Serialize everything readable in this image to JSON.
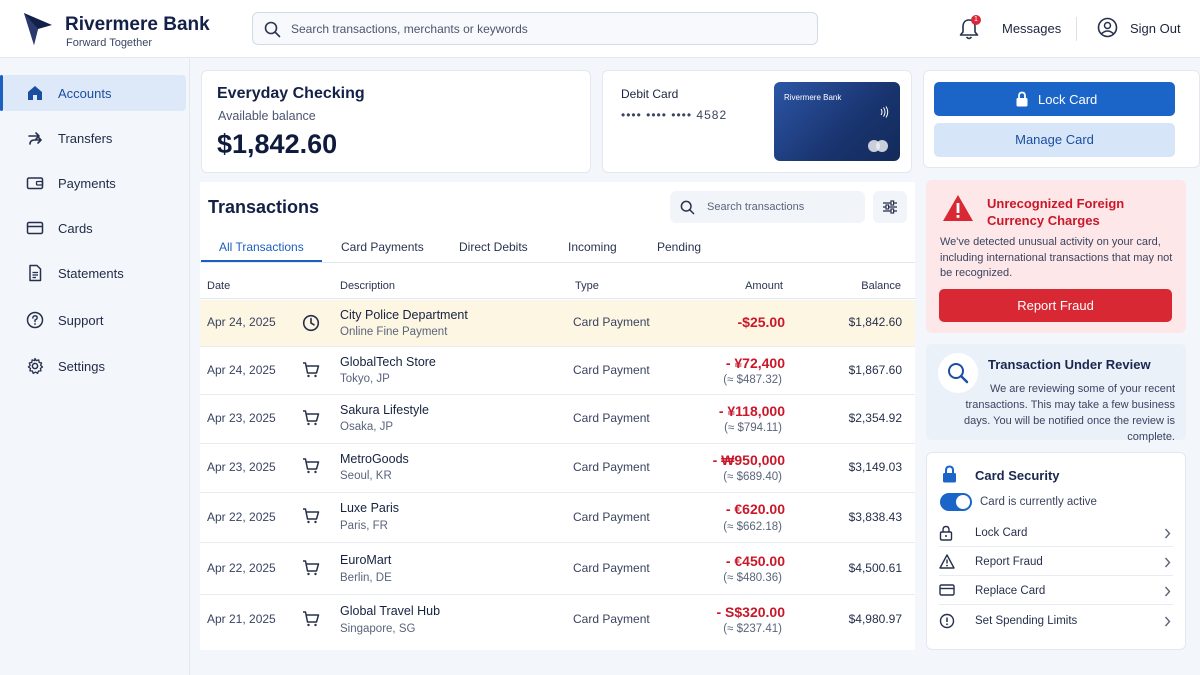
{
  "brand": {
    "name": "Rivermere Bank",
    "tagline": "Forward Together"
  },
  "header": {
    "search_placeholder": "Search transactions, merchants or keywords",
    "notification_count": "1",
    "messages_label": "Messages",
    "sign_out_label": "Sign Out"
  },
  "sidebar": {
    "items": [
      {
        "label": "Accounts",
        "icon": "home-icon",
        "active": true
      },
      {
        "label": "Transfers",
        "icon": "transfer-arrows-icon"
      },
      {
        "label": "Payments",
        "icon": "wallet-icon"
      },
      {
        "label": "Cards",
        "icon": "credit-card-icon"
      },
      {
        "label": "Statements",
        "icon": "document-icon"
      },
      {
        "label": "Support",
        "icon": "help-circle-icon"
      },
      {
        "label": "Settings",
        "icon": "gear-icon"
      }
    ]
  },
  "account": {
    "name": "Everyday Checking",
    "balance_label": "Available balance",
    "balance": "$1,842.60"
  },
  "debit_card": {
    "title": "Debit Card",
    "masked_number": "•••• •••• •••• 4582",
    "card_brand_text": "Rivermere Bank"
  },
  "transactions": {
    "title": "Transactions",
    "search_placeholder": "Search transactions",
    "tabs": [
      "All Transactions",
      "Card Payments",
      "Direct Debits",
      "Incoming",
      "Pending"
    ],
    "active_tab": "All Transactions",
    "columns": [
      "Date",
      "Description",
      "Type",
      "Amount",
      "Balance"
    ],
    "rows": [
      {
        "date": "Apr 24, 2025",
        "icon": "clock-icon",
        "merchant": "City Police Department",
        "sub": "Online Fine Payment",
        "type": "Card Payment",
        "amount": "-$25.00",
        "converted": "",
        "balance": "$1,842.60",
        "highlighted": true
      },
      {
        "date": "Apr 24, 2025",
        "icon": "cart-icon",
        "merchant": "GlobalTech Store",
        "sub": "Tokyo, JP",
        "type": "Card Payment",
        "amount": "- ¥72,400",
        "converted": "(≈ $487.32)",
        "balance": "$1,867.60"
      },
      {
        "date": "Apr 23, 2025",
        "icon": "cart-icon",
        "merchant": "Sakura Lifestyle",
        "sub": "Osaka, JP",
        "type": "Card Payment",
        "amount": "- ¥118,000",
        "converted": "(≈ $794.11)",
        "balance": "$2,354.92"
      },
      {
        "date": "Apr 23, 2025",
        "icon": "cart-icon",
        "merchant": "MetroGoods",
        "sub": "Seoul, KR",
        "type": "Card Payment",
        "amount": "- ₩950,000",
        "converted": "(≈ $689.40)",
        "balance": "$3,149.03"
      },
      {
        "date": "Apr 22, 2025",
        "icon": "cart-icon",
        "merchant": "Luxe Paris",
        "sub": "Paris, FR",
        "type": "Card Payment",
        "amount": "- €620.00",
        "converted": "(≈ $662.18)",
        "balance": "$3,838.43"
      },
      {
        "date": "Apr 22, 2025",
        "icon": "cart-icon",
        "merchant": "EuroMart",
        "sub": "Berlin, DE",
        "type": "Card Payment",
        "amount": "- €450.00",
        "converted": "(≈ $480.36)",
        "balance": "$4,500.61"
      },
      {
        "date": "Apr 21, 2025",
        "icon": "cart-icon",
        "merchant": "Global Travel Hub",
        "sub": "Singapore, SG",
        "type": "Card Payment",
        "amount": "- S$320.00",
        "converted": "(≈ $237.41)",
        "balance": "$4,980.97"
      }
    ]
  },
  "card_actions": {
    "lock_label": "Lock Card",
    "manage_label": "Manage Card"
  },
  "alert": {
    "title": "Unrecognized Foreign Currency Charges",
    "text": "We've detected unusual activity on your card, including international transactions that may not be recognized.",
    "button_label": "Report Fraud"
  },
  "review": {
    "title": "Transaction Under Review",
    "text": "We are reviewing some of your recent transactions. This may take a few business days. You will be notified once the review is complete."
  },
  "security": {
    "title": "Card Security",
    "toggle_label": "Card is currently active",
    "toggle_on": true,
    "items": [
      {
        "label": "Lock Card",
        "icon": "lock-icon"
      },
      {
        "label": "Report Fraud",
        "icon": "warning-icon"
      },
      {
        "label": "Replace Card",
        "icon": "card-icon"
      },
      {
        "label": "Set Spending Limits",
        "icon": "limit-icon"
      }
    ]
  },
  "colors": {
    "primary": "#1b64c8",
    "danger": "#d72833",
    "amount_negative": "#c8182a",
    "highlight_row": "#fdf6e3",
    "brand_navy": "#132047"
  }
}
